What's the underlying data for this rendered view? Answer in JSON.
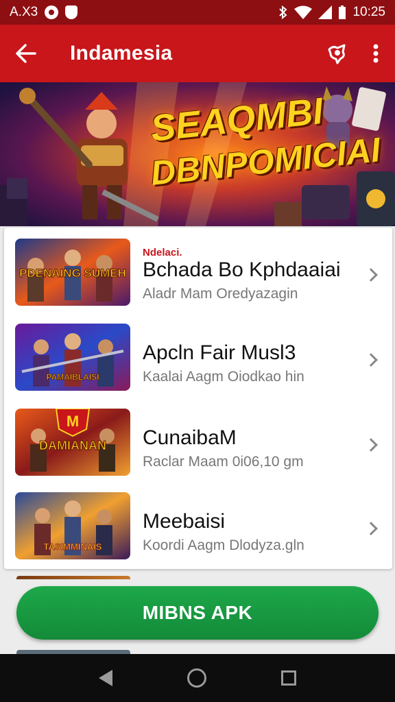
{
  "status_bar": {
    "left_text": "A.X3",
    "time": "10:25",
    "icons": [
      "circle-app-icon",
      "shield-icon",
      "bluetooth-icon",
      "wifi-icon",
      "signal-icon",
      "battery-icon"
    ]
  },
  "app_bar": {
    "title": "Indamesia",
    "back_icon": "arrow-left-icon",
    "share_icon": "share-icon",
    "more_icon": "more-vert-icon",
    "color": "#c8161b"
  },
  "banner": {
    "line1": "SEAQMBI",
    "line2": "DBNPOMICIAI"
  },
  "list": {
    "items": [
      {
        "tag": "Ndelaci.",
        "title": "Bchada Bo Kphdaaiai",
        "subtitle": "Aladr Mam Oredyazagin",
        "thumb_text": "PDENAING SUMEH"
      },
      {
        "tag": "",
        "title": "Apcln Fair Musl3",
        "subtitle": "Kaalai Aagm Oiodkao hin",
        "thumb_text": "PAMAIBLAISI"
      },
      {
        "tag": "",
        "title": "CunaibaM",
        "subtitle": "Raclar Maam 0i06,10 gm",
        "thumb_text": "DAMIANAN"
      },
      {
        "tag": "",
        "title": "Meebaisi",
        "subtitle": "Koordi Aagm Dlodyza.gln",
        "thumb_text": "TASIMMINAIS"
      }
    ]
  },
  "cta": {
    "label": "MIBNS APK",
    "color": "#1ea84a"
  },
  "nav_bar": {
    "icons": [
      "nav-back-icon",
      "nav-home-icon",
      "nav-recents-icon"
    ]
  }
}
